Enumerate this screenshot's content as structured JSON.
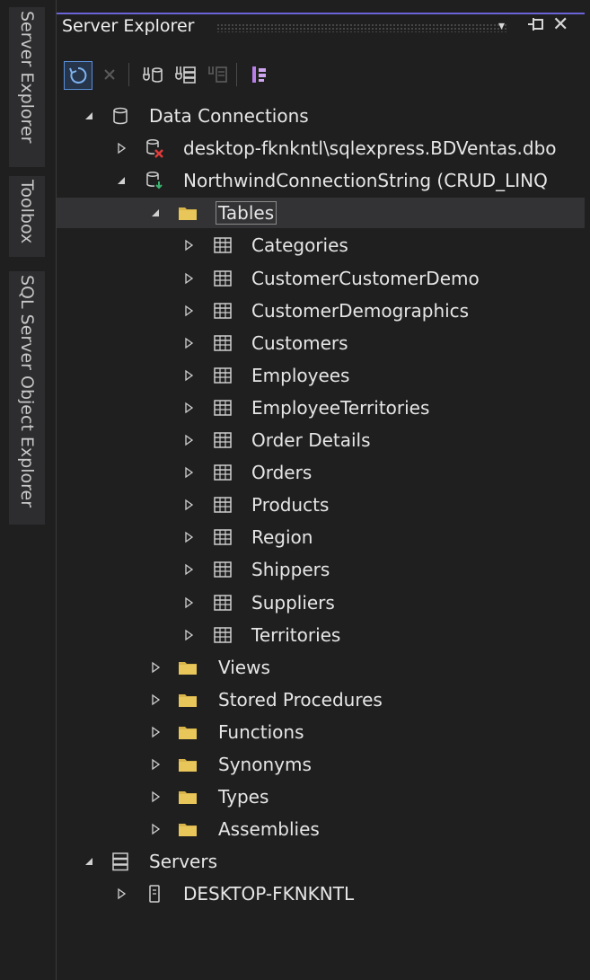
{
  "side_tabs": [
    "Server Explorer",
    "Toolbox",
    "SQL Server Object Explorer"
  ],
  "panel": {
    "title": "Server Explorer",
    "dropdown_glyph": "▾",
    "pin_glyph": "⊣",
    "close_glyph": "✕"
  },
  "toolbar": {
    "icons": [
      "refresh-icon",
      "stop-icon",
      "connect-to-database-icon",
      "connect-to-server-icon",
      "connect-to-sharepoint-icon",
      "azure-icon"
    ]
  },
  "tree": {
    "data_connections": "Data Connections",
    "conn1": "desktop-fknkntl\\sqlexpress.BDVentas.dbo",
    "conn2": "NorthwindConnectionString (CRUD_LINQ",
    "tables_folder": "Tables",
    "tables": [
      "Categories",
      "CustomerCustomerDemo",
      "CustomerDemographics",
      "Customers",
      "Employees",
      "EmployeeTerritories",
      "Order Details",
      "Orders",
      "Products",
      "Region",
      "Shippers",
      "Suppliers",
      "Territories"
    ],
    "folders": [
      "Views",
      "Stored Procedures",
      "Functions",
      "Synonyms",
      "Types",
      "Assemblies"
    ],
    "servers": "Servers",
    "server1": "DESKTOP-FKNKNTL"
  },
  "colors": {
    "background": "#1f1f1f",
    "accent": "#6b63d8",
    "folder": "#d8b44a",
    "error": "#e23b3b",
    "ok": "#3cb371"
  }
}
